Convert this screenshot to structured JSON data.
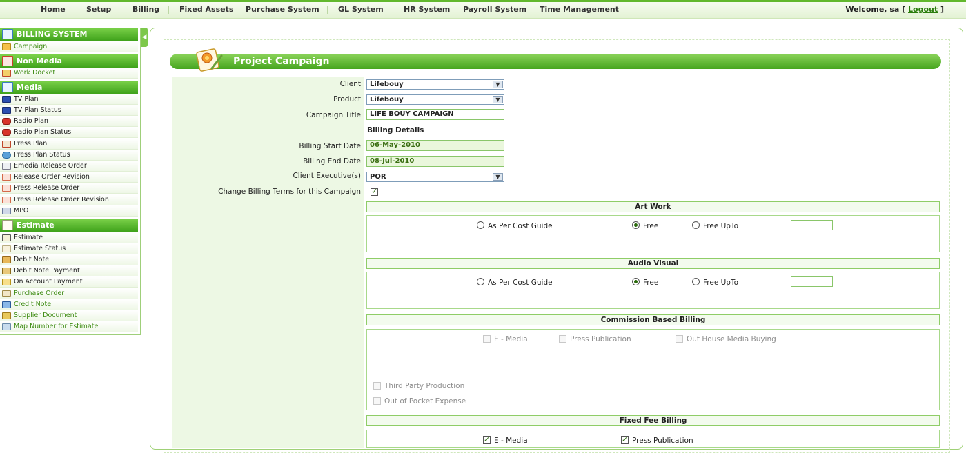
{
  "topnav": {
    "items": [
      "Home",
      "Setup",
      "Billing",
      "Fixed Assets",
      "Purchase System",
      "GL System",
      "HR System",
      "Payroll System",
      "Time Management"
    ],
    "welcome_text": "Welcome,",
    "user": "sa",
    "logout": "Logout",
    "bracket_open": "[",
    "bracket_close": "]"
  },
  "sidebar": {
    "collapse_glyph": "◀",
    "headings": [
      "BILLING SYSTEM",
      "Non Media",
      "Media",
      "Estimate"
    ],
    "items": [
      "Campaign",
      "Work Docket",
      "TV Plan",
      "TV Plan Status",
      "Radio Plan",
      "Radio Plan Status",
      "Press Plan",
      "Press Plan Status",
      "Emedia Release Order",
      "Release Order Revision",
      "Press Release Order",
      "Press Release Order Revision",
      "MPO",
      "Estimate",
      "Estimate Status",
      "Debit Note",
      "Debit Note Payment",
      "On Account Payment",
      "Purchase Order",
      "Credit Note",
      "Supplier Document",
      "Map Number for Estimate"
    ]
  },
  "page": {
    "title": "Project Campaign"
  },
  "form": {
    "labels": {
      "client": "Client",
      "product": "Product",
      "campaign_title": "Campaign Title",
      "billing_start": "Billing Start Date",
      "billing_end": "Billing End Date",
      "client_exec": "Client Executive(s)",
      "change_terms": "Change Billing Terms for this Campaign"
    },
    "client_value": "Lifebouy",
    "product_value": "Lifebouy",
    "campaign_title_value": "LIFE BOUY CAMPAIGN",
    "billing_details": "Billing Details",
    "billing_start_value": "06-May-2010",
    "billing_end_value": "08-Jul-2010",
    "client_exec_value": "PQR",
    "select_arrow": "▼"
  },
  "sections": {
    "artwork": {
      "title": "Art Work",
      "options": [
        "As Per Cost Guide",
        "Free",
        "Free UpTo"
      ]
    },
    "audio_visual": {
      "title": "Audio Visual",
      "options": [
        "As Per Cost Guide",
        "Free",
        "Free UpTo"
      ]
    },
    "commission": {
      "title": "Commission Based Billing",
      "options": [
        "E - Media",
        "Press Publication",
        "Out House Media Buying",
        "Third Party Production",
        "Out of Pocket Expense"
      ]
    },
    "fixed_fee": {
      "title": "Fixed Fee Billing",
      "options": [
        "E - Media",
        "Press Publication"
      ]
    }
  }
}
